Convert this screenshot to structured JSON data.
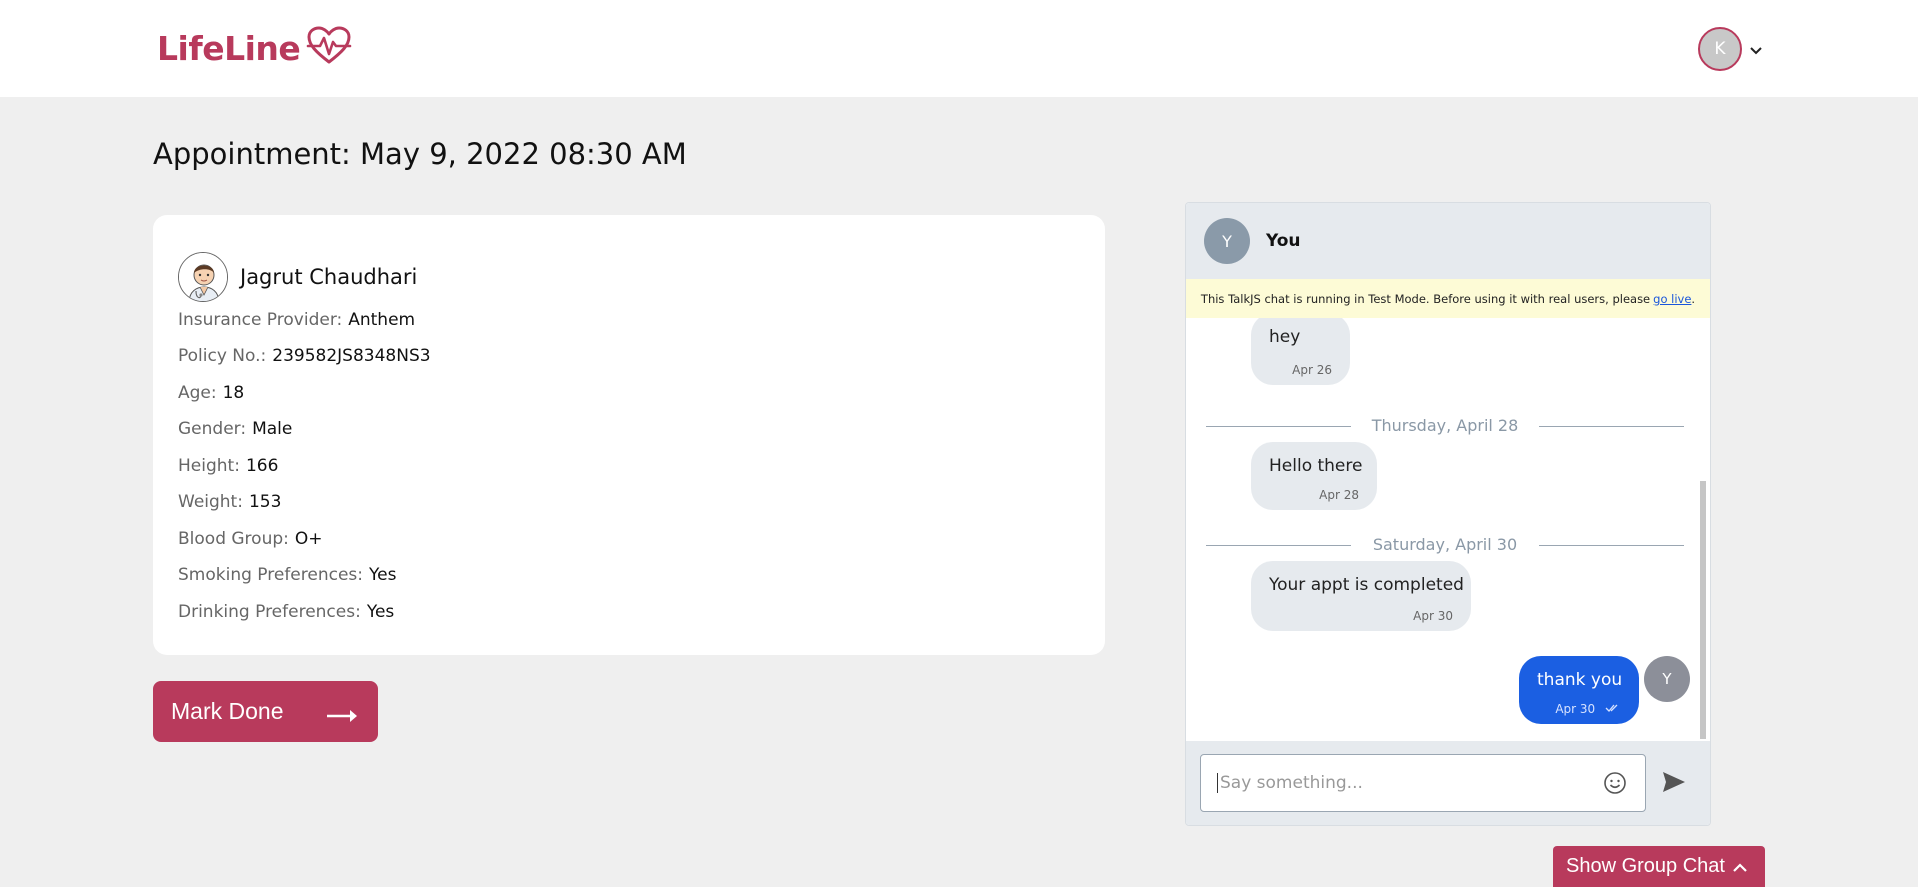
{
  "nav": {
    "logo_text": "LifeLine",
    "user_initial": "K"
  },
  "page": {
    "title": "Appointment: May 9, 2022 08:30 AM"
  },
  "patient": {
    "name": "Jagrut Chaudhari",
    "fields": [
      {
        "label": "Insurance Provider:",
        "value": "Anthem"
      },
      {
        "label": "Policy No.:",
        "value": "239582JS8348NS3"
      },
      {
        "label": "Age:",
        "value": "18"
      },
      {
        "label": "Gender:",
        "value": "Male"
      },
      {
        "label": "Height:",
        "value": "166"
      },
      {
        "label": "Weight:",
        "value": "153"
      },
      {
        "label": "Blood Group:",
        "value": "O+"
      },
      {
        "label": "Smoking Preferences:",
        "value": "Yes"
      },
      {
        "label": "Drinking Preferences:",
        "value": "Yes"
      }
    ]
  },
  "actions": {
    "mark_done": "Mark Done",
    "show_group_chat": "Show Group Chat"
  },
  "chat": {
    "header_initial": "Y",
    "header_title": "You",
    "test_banner": "This TalkJS chat is running in Test Mode. Before using it with real users, please",
    "test_banner_link": "go live",
    "messages": [
      {
        "text": "hey",
        "time": "Apr 26"
      },
      {
        "text": "Hello there",
        "time": "Apr 28"
      },
      {
        "text": "Your appt is completed",
        "time": "Apr 30"
      },
      {
        "text": "thank you",
        "time": "Apr 30"
      }
    ],
    "day_separators": [
      "Thursday, April 28",
      "Saturday, April 30"
    ],
    "my_initial": "Y",
    "composer_placeholder": "Say something..."
  },
  "colors": {
    "brand": "#b83a5c",
    "my_bubble": "#1b5fe2",
    "page_bg": "#efefef"
  }
}
